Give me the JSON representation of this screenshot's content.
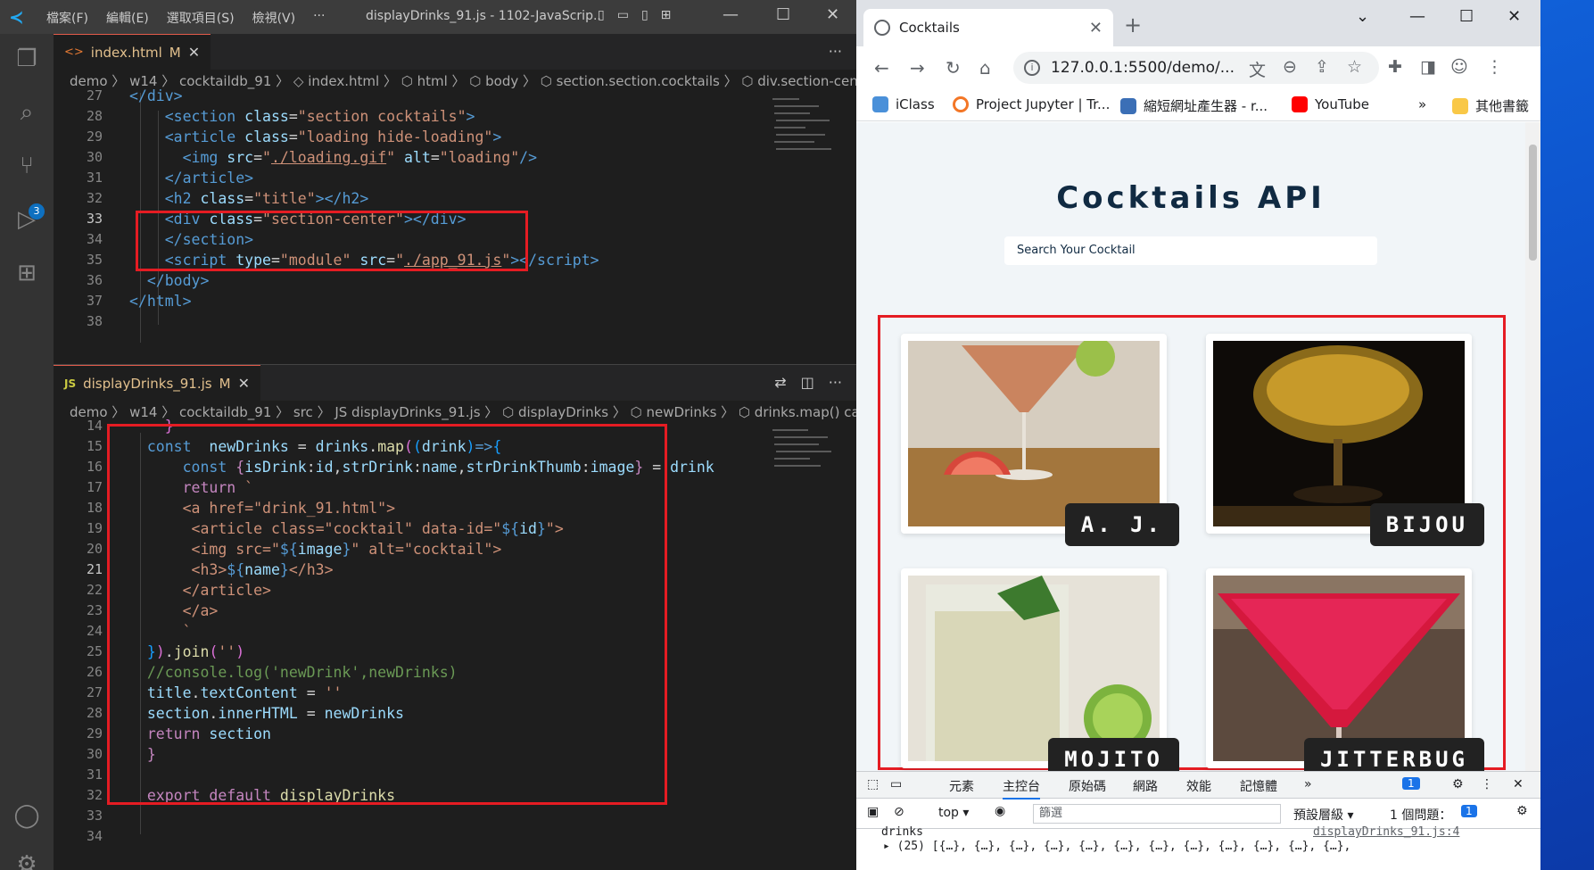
{
  "vscode": {
    "menu": [
      "檔案(F)",
      "編輯(E)",
      "選取項目(S)",
      "檢視(V)",
      "···"
    ],
    "window_title": "displayDrinks_91.js - 1102-JavaScrip...",
    "scm_badge": "3",
    "top_pane": {
      "tab_label": "index.html",
      "tab_modified": "M",
      "breadcrumb": "demo 〉 w14 〉 cocktaildb_91 〉 ◇ index.html 〉 ⬡ html 〉 ⬡ body 〉 ⬡ section.section.cocktails 〉 ⬡ div.section-center",
      "line_numbers": [
        "27",
        "28",
        "29",
        "30",
        "31",
        "32",
        "33",
        "34",
        "35",
        "36",
        "37",
        "38"
      ]
    },
    "bottom_pane": {
      "tab_label": "displayDrinks_91.js",
      "tab_modified": "M",
      "breadcrumb": "demo 〉 w14 〉 cocktaildb_91 〉 src 〉 JS displayDrinks_91.js 〉 ⬡ displayDrinks 〉 ⬡ newDrinks 〉 ⬡ drinks.map() callback",
      "line_numbers": [
        "14",
        "15",
        "16",
        "17",
        "18",
        "19",
        "20",
        "21",
        "22",
        "23",
        "24",
        "25",
        "26",
        "27",
        "28",
        "29",
        "30",
        "31",
        "32",
        "33",
        "34"
      ]
    }
  },
  "chrome": {
    "tab_title": "Cocktails",
    "url": "127.0.0.1:5500/demo/...",
    "bookmarks": [
      "iClass",
      "Project Jupyter | Tr...",
      "縮短網址產生器 - r...",
      "YouTube",
      "»",
      "其他書籤"
    ],
    "page": {
      "title": "Cocktails API",
      "search_placeholder": "Search Your Cocktail",
      "cocktails": [
        "A. J.",
        "BIJOU",
        "MOJITO",
        "JITTERBUG"
      ]
    },
    "devtools": {
      "tabs": [
        "元素",
        "主控台",
        "原始碼",
        "網路",
        "效能",
        "記憶體",
        "»"
      ],
      "active_tab": "主控台",
      "issues_badge": "1",
      "context": "top ▾",
      "filter_placeholder": "篩選",
      "levels": "預設層級 ▾",
      "issues": "1 個問題：",
      "issues_count": "1",
      "console_label": "drinks",
      "console_source": "displayDrinks_91.js:4",
      "console_line": "▸ (25) [{…}, {…}, {…}, {…}, {…}, {…}, {…}, {…}, {…}, {…}, {…}, {…},"
    }
  }
}
